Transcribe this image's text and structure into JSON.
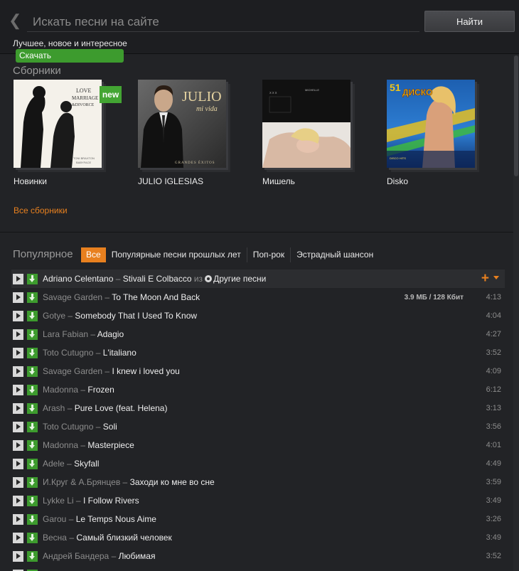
{
  "header": {
    "search_placeholder": "Искать песни на сайте",
    "search_button": "Найти",
    "subtitle": "Лучшее, новое и интересное",
    "download_badge": "Скачать"
  },
  "collections": {
    "title": "Сборники",
    "new_badge": "new",
    "all_link": "Все сборники",
    "items": [
      {
        "name": "Новинки"
      },
      {
        "name": "JULIO IGLESIAS"
      },
      {
        "name": "Мишель"
      },
      {
        "name": "Disko"
      }
    ]
  },
  "popular": {
    "title": "Популярное",
    "filters": [
      "Все",
      "Популярные песни прошлых лет",
      "Поп-рок",
      "Эстрадный шансон"
    ]
  },
  "tracks": [
    {
      "artist": "Adriano Celentano",
      "title": "Stivali E Colbacco",
      "from_label": "из",
      "from_album": "Другие песни",
      "duration": ""
    },
    {
      "artist": "Savage Garden",
      "title": "To The Moon And Back",
      "size": "3.9 МБ / 128 Кбит",
      "duration": "4:13"
    },
    {
      "artist": "Gotye",
      "title": "Somebody That I Used To Know",
      "duration": "4:04"
    },
    {
      "artist": "Lara Fabian",
      "title": "Adagio",
      "duration": "4:27"
    },
    {
      "artist": "Toto Cutugno",
      "title": "L'italiano",
      "duration": "3:52"
    },
    {
      "artist": "Savage Garden",
      "title": "I knew i loved you",
      "duration": "4:09"
    },
    {
      "artist": "Madonna",
      "title": "Frozen",
      "duration": "6:12"
    },
    {
      "artist": "Arash",
      "title": "Pure Love (feat. Helena)",
      "duration": "3:13"
    },
    {
      "artist": "Toto Cutugno",
      "title": "Soli",
      "duration": "3:56"
    },
    {
      "artist": "Madonna",
      "title": "Masterpiece",
      "duration": "4:01"
    },
    {
      "artist": "Adele",
      "title": "Skyfall",
      "duration": "4:49"
    },
    {
      "artist": "И.Круг & А.Брянцев",
      "title": "Заходи ко мне во сне",
      "duration": "3:59"
    },
    {
      "artist": "Lykke Li",
      "title": "I Follow Rivers",
      "duration": "3:49"
    },
    {
      "artist": "Garou",
      "title": "Le Temps Nous Aime",
      "duration": "3:26"
    },
    {
      "artist": "Весна",
      "title": "Самый близкий человек",
      "duration": "3:49"
    },
    {
      "artist": "Андрей Бандера",
      "title": "Любимая",
      "duration": "3:52"
    }
  ],
  "separator": "–",
  "colors": {
    "accent_orange": "#e8801f",
    "download_green": "#3d9b2e",
    "background": "#222326"
  }
}
